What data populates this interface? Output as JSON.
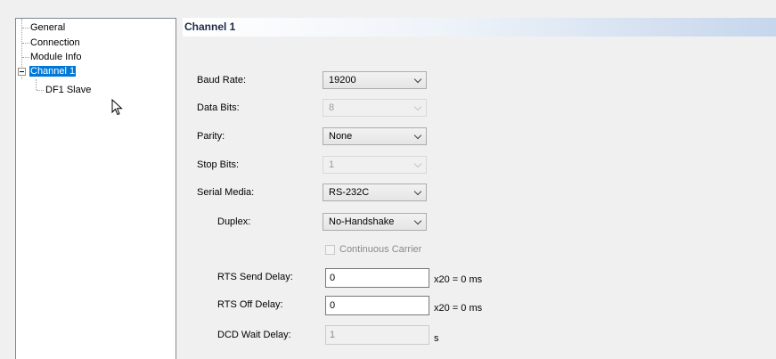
{
  "tree": {
    "items": [
      {
        "label": "General"
      },
      {
        "label": "Connection"
      },
      {
        "label": "Module Info"
      },
      {
        "label": "Channel 1"
      },
      {
        "label": "DF1 Slave"
      }
    ]
  },
  "header": {
    "title": "Channel 1"
  },
  "form": {
    "baud_rate": {
      "label": "Baud Rate:",
      "value": "19200"
    },
    "data_bits": {
      "label": "Data Bits:",
      "value": "8"
    },
    "parity": {
      "label": "Parity:",
      "value": "None"
    },
    "stop_bits": {
      "label": "Stop Bits:",
      "value": "1"
    },
    "serial_media": {
      "label": "Serial Media:",
      "value": "RS-232C"
    },
    "duplex": {
      "label": "Duplex:",
      "value": "No-Handshake"
    },
    "continuous_carrier": {
      "label": "Continuous Carrier",
      "checked": false
    },
    "rts_send_delay": {
      "label": "RTS Send Delay:",
      "value": "0",
      "suffix": "x20 = 0 ms"
    },
    "rts_off_delay": {
      "label": "RTS Off Delay:",
      "value": "0",
      "suffix": "x20 = 0 ms"
    },
    "dcd_wait_delay": {
      "label": "DCD Wait Delay:",
      "value": "1",
      "suffix": "s"
    }
  },
  "colors": {
    "selection": "#0078d7",
    "header_gradient_end": "#c6d6ec"
  }
}
